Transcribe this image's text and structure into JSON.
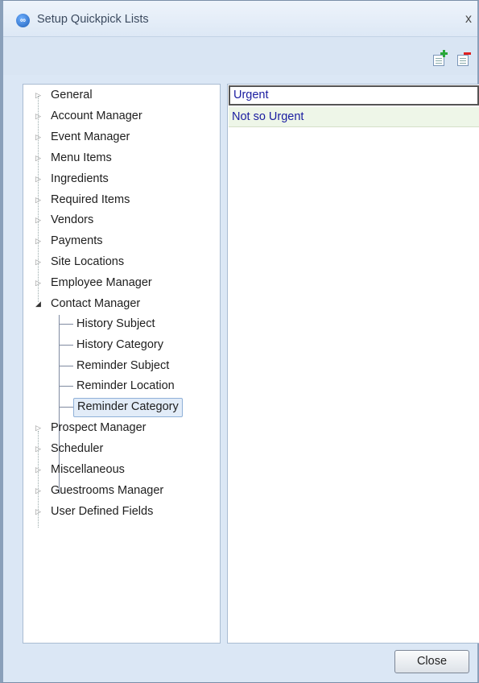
{
  "window": {
    "title": "Setup Quickpick Lists",
    "close_glyph": "x"
  },
  "toolbar": {
    "add_icon": "add-list-icon",
    "delete_icon": "delete-list-icon"
  },
  "tree": {
    "top_items_before": [
      "General",
      "Account Manager",
      "Event Manager",
      "Menu Items",
      "Ingredients",
      "Required Items",
      "Vendors",
      "Payments",
      "Site Locations",
      "Employee Manager"
    ],
    "expanded_item": "Contact Manager",
    "children": [
      "History Subject",
      "History Category",
      "Reminder Subject",
      "Reminder Location",
      "Reminder Category"
    ],
    "selected_child": "Reminder Category",
    "top_items_after": [
      "Prospect Manager",
      "Scheduler",
      "Miscellaneous",
      "Guestrooms Manager",
      "User Defined Fields"
    ]
  },
  "list": {
    "rows": [
      "Urgent",
      "Not so Urgent"
    ]
  },
  "footer": {
    "close_label": "Close"
  },
  "colors": {
    "selected_text": "#1a1ca0",
    "row_alt_bg": "#eef6e8",
    "tree_selected_bg": "#e2ecf8"
  }
}
